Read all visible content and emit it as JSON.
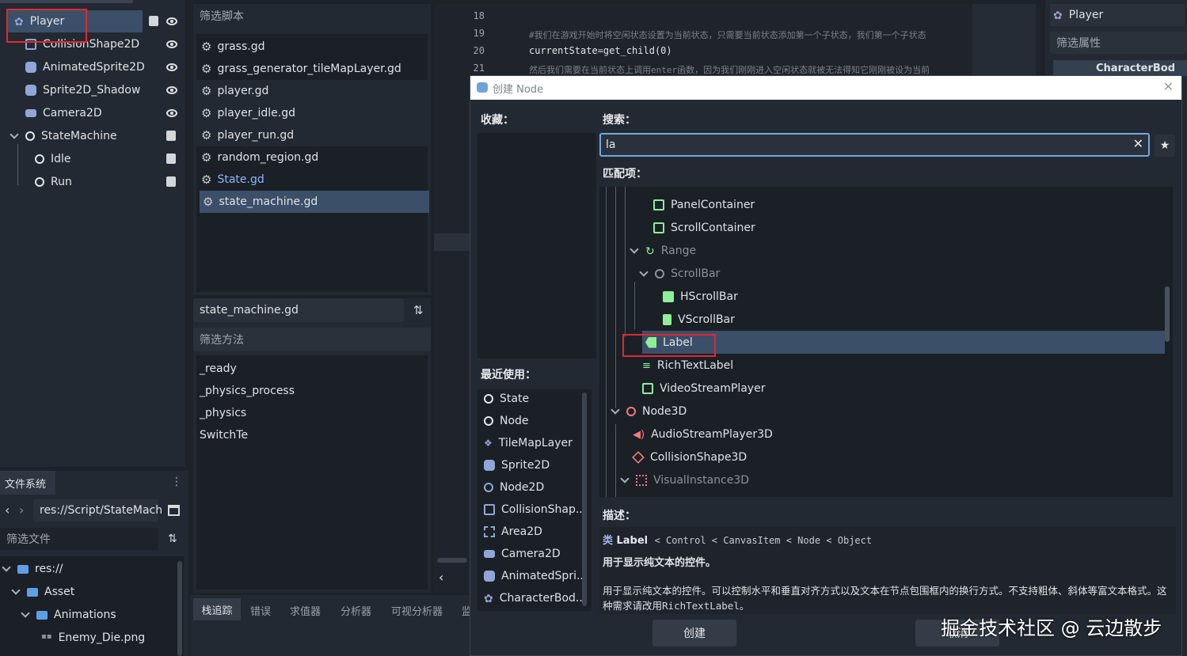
{
  "scene_tree": {
    "items": [
      {
        "label": "Player",
        "icon": "character-body-icon",
        "indent": 0
      },
      {
        "label": "CollisionShape2D",
        "icon": "collision-shape-icon",
        "indent": 1
      },
      {
        "label": "AnimatedSprite2D",
        "icon": "animated-sprite-icon",
        "indent": 1
      },
      {
        "label": "Sprite2D_Shadow",
        "icon": "sprite-icon",
        "indent": 1
      },
      {
        "label": "Camera2D",
        "icon": "camera-icon",
        "indent": 1
      },
      {
        "label": "StateMachine",
        "icon": "node-icon",
        "indent": 1
      },
      {
        "label": "Idle",
        "icon": "node-icon",
        "indent": 2
      },
      {
        "label": "Run",
        "icon": "node-icon",
        "indent": 2
      }
    ]
  },
  "filesystem": {
    "tab": "文件系统",
    "path": "res://Script/StateMach",
    "filter_placeholder": "筛选文件",
    "items": [
      {
        "label": "res://"
      },
      {
        "label": "Asset"
      },
      {
        "label": "Animations"
      },
      {
        "label": "Enemy_Die.png"
      }
    ]
  },
  "script_panel": {
    "filter_placeholder": "筛选脚本",
    "scripts": [
      {
        "label": "grass.gd"
      },
      {
        "label": "grass_generator_tileMapLayer.gd"
      },
      {
        "label": "player.gd"
      },
      {
        "label": "player_idle.gd"
      },
      {
        "label": "player_run.gd"
      },
      {
        "label": "random_region.gd"
      },
      {
        "label": "State.gd"
      },
      {
        "label": "state_machine.gd"
      }
    ],
    "current_script": "state_machine.gd",
    "method_filter_placeholder": "筛选方法",
    "methods": [
      {
        "label": "_ready"
      },
      {
        "label": "_physics_process"
      },
      {
        "label": "_physics"
      },
      {
        "label": "SwitchTe"
      }
    ]
  },
  "bottom_tabs": [
    {
      "label": "栈追踪"
    },
    {
      "label": "错误"
    },
    {
      "label": "求值器"
    },
    {
      "label": "分析器"
    },
    {
      "label": "可视分析器"
    },
    {
      "label": "监"
    }
  ],
  "code_editor": {
    "lines": [
      {
        "num": "18",
        "text": ""
      },
      {
        "num": "19",
        "text": "#我们在游戏开始时将空闲状态设置为当前状态，只需要当前状态添加第一个子状态，我们第一个子状态"
      },
      {
        "num": "20",
        "text": "currentState=get_child(0)"
      },
      {
        "num": "21",
        "text": "然后我们需要在当前状态上调用enter函数，因为我们刚刚进入空闲状态就被无法得知它刚刚被设为当前"
      }
    ]
  },
  "inspector": {
    "node_name": "Player",
    "filter_placeholder": "筛选属性",
    "class_header": "CharacterBod"
  },
  "dialog": {
    "title": "创建 Node",
    "favorites_label": "收藏：",
    "search_label": "搜索：",
    "search_value": "la",
    "matches_label": "匹配项：",
    "recent_label": "最近使用：",
    "recent": [
      {
        "label": "State"
      },
      {
        "label": "Node"
      },
      {
        "label": "TileMapLayer"
      },
      {
        "label": "Sprite2D"
      },
      {
        "label": "Node2D"
      },
      {
        "label": "CollisionShap..."
      },
      {
        "label": "Area2D"
      },
      {
        "label": "Camera2D"
      },
      {
        "label": "AnimatedSpri..."
      },
      {
        "label": "CharacterBod..."
      }
    ],
    "tree": [
      {
        "label": "PanelContainer"
      },
      {
        "label": "ScrollContainer"
      },
      {
        "label": "Range"
      },
      {
        "label": "ScrollBar"
      },
      {
        "label": "HScrollBar"
      },
      {
        "label": "VScrollBar"
      },
      {
        "label": "Label"
      },
      {
        "label": "RichTextLabel"
      },
      {
        "label": "VideoStreamPlayer"
      },
      {
        "label": "Node3D"
      },
      {
        "label": "AudioStreamPlayer3D"
      },
      {
        "label": "CollisionShape3D"
      },
      {
        "label": "VisualInstance3D"
      }
    ],
    "description_label": "描述：",
    "desc_class_prefix": "类",
    "desc_class": "Label",
    "desc_inheritance": "< Control < CanvasItem < Node < Object",
    "desc_short": "用于显示纯文本的控件。",
    "desc_long": "用于显示纯文本的控件。可以控制水平和垂直对齐方式以及文本在节点包围框内的换行方式。不支持粗体、斜体等富文本格式。这种需求请改用",
    "desc_long_link": "RichTextLabel",
    "desc_long_end": "。",
    "create_button": "创建",
    "cancel_button": "取消"
  },
  "watermark": "掘金技术社区 @ 云边散步"
}
